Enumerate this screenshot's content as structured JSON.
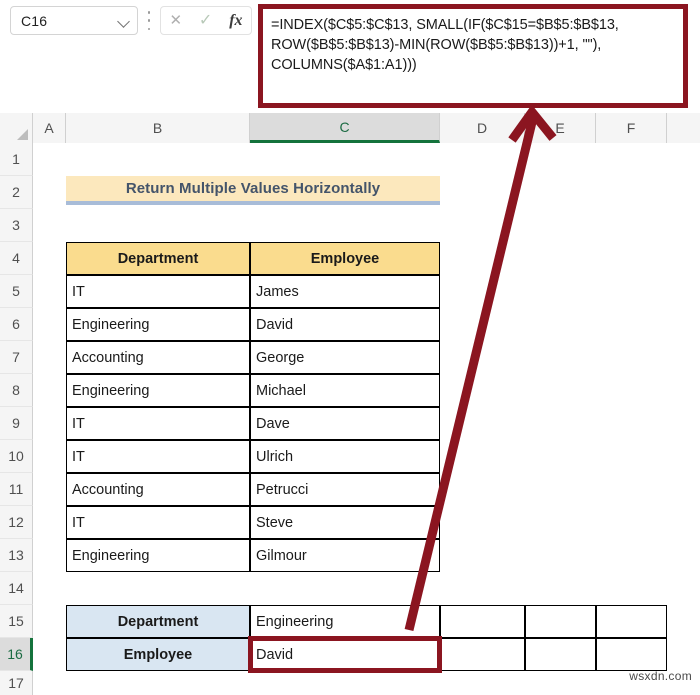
{
  "formula_bar": {
    "name_box_value": "C16",
    "cancel_icon": "cancel-icon",
    "confirm_icon": "confirm-icon",
    "function_icon": "fx-icon",
    "dropdown_icon": "chevron-down-icon",
    "formula": "=INDEX($C$5:$C$13, SMALL(IF($C$15=$B$5:$B$13, ROW($B$5:$B$13)-MIN(ROW($B$5:$B$13))+1, \"\"), COLUMNS($A$1:A1)))"
  },
  "grid": {
    "columns": [
      "A",
      "B",
      "C",
      "D",
      "E",
      "F"
    ],
    "selected_column": "C",
    "rows": [
      "1",
      "2",
      "3",
      "4",
      "5",
      "6",
      "7",
      "8",
      "9",
      "10",
      "11",
      "12",
      "13",
      "14",
      "15",
      "16",
      "17"
    ],
    "selected_row": "16"
  },
  "title_banner": {
    "text": "Return Multiple Values Horizontally"
  },
  "table": {
    "headers": [
      "Department",
      "Employee"
    ],
    "rows": [
      {
        "department": "IT",
        "employee": "James"
      },
      {
        "department": "Engineering",
        "employee": "David"
      },
      {
        "department": "Accounting",
        "employee": "George"
      },
      {
        "department": "Engineering",
        "employee": "Michael"
      },
      {
        "department": "IT",
        "employee": "Dave"
      },
      {
        "department": "IT",
        "employee": "Ulrich"
      },
      {
        "department": "Accounting",
        "employee": "Petrucci"
      },
      {
        "department": "IT",
        "employee": "Steve"
      },
      {
        "department": "Engineering",
        "employee": "Gilmour"
      }
    ]
  },
  "result_section": {
    "department_label": "Department",
    "department_value": "Engineering",
    "employee_label": "Employee",
    "employee_value": "David",
    "empty_cells": [
      "",
      "",
      "",
      "",
      "",
      ""
    ]
  },
  "watermark": {
    "text": "wsxdn.com"
  },
  "colors": {
    "selection_red": "#8b1520",
    "header_amber": "#fadc8e",
    "banner_cream": "#fce8bd",
    "label_blue": "#d9e6f2",
    "excel_green": "#14733c",
    "title_navy": "#44546a"
  }
}
